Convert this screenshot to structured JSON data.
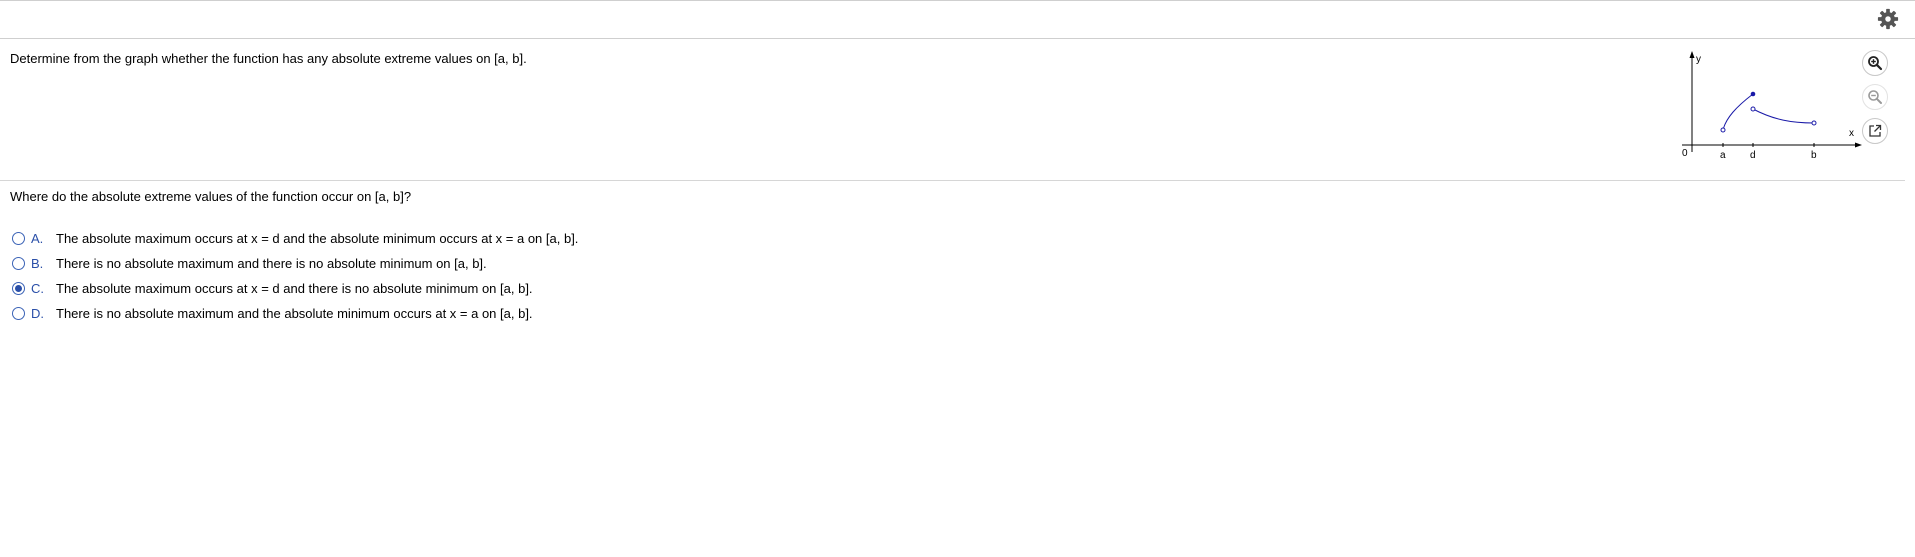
{
  "question": "Determine from the graph whether the function has any absolute extreme values on [a, b].",
  "prompt": "Where do the absolute extreme values of the function occur on [a, b]?",
  "graph": {
    "axis_labels": {
      "y": "y",
      "x": "x",
      "origin": "0"
    },
    "tick_labels": [
      "a",
      "d",
      "b"
    ],
    "curve_color": "#1a1aa8",
    "points": {
      "a": "open circle",
      "d_first_branch": "closed dot (maximum)",
      "d_second_branch": "open circle",
      "b": "open circle"
    }
  },
  "toolbar": {
    "icons": [
      "gear-icon",
      "zoom-in-icon",
      "zoom-out-icon",
      "popout-icon"
    ]
  },
  "options": [
    {
      "letter": "A.",
      "text": "The absolute maximum occurs at x = d and the absolute minimum occurs at x = a on [a, b].",
      "selected": false
    },
    {
      "letter": "B.",
      "text": "There is no absolute maximum and there is no absolute minimum on [a, b].",
      "selected": false
    },
    {
      "letter": "C.",
      "text": "The absolute maximum occurs at x = d and there is no absolute minimum on [a, b].",
      "selected": true
    },
    {
      "letter": "D.",
      "text": "There is no absolute maximum and the absolute minimum occurs at x = a on [a, b].",
      "selected": false
    }
  ]
}
